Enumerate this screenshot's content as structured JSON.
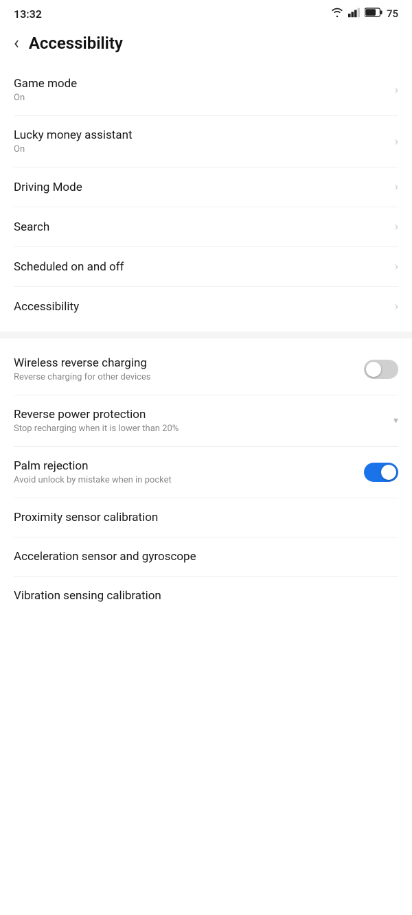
{
  "statusBar": {
    "time": "13:32",
    "battery": "75"
  },
  "header": {
    "backLabel": "‹",
    "title": "Accessibility"
  },
  "menuItems": [
    {
      "id": "game-mode",
      "title": "Game mode",
      "subtitle": "On",
      "control": "chevron"
    },
    {
      "id": "lucky-money",
      "title": "Lucky money assistant",
      "subtitle": "On",
      "control": "chevron"
    },
    {
      "id": "driving-mode",
      "title": "Driving Mode",
      "subtitle": "",
      "control": "chevron"
    },
    {
      "id": "search",
      "title": "Search",
      "subtitle": "",
      "control": "chevron"
    },
    {
      "id": "scheduled",
      "title": "Scheduled on and off",
      "subtitle": "",
      "control": "chevron"
    },
    {
      "id": "accessibility",
      "title": "Accessibility",
      "subtitle": "",
      "control": "chevron"
    }
  ],
  "hardwareItems": [
    {
      "id": "wireless-charging",
      "title": "Wireless reverse charging",
      "subtitle": "Reverse charging for other devices",
      "control": "toggle-off"
    },
    {
      "id": "reverse-protection",
      "title": "Reverse power protection",
      "subtitle": "Stop recharging when it is lower than 20%",
      "control": "dropdown"
    },
    {
      "id": "palm-rejection",
      "title": "Palm rejection",
      "subtitle": "Avoid unlock by mistake when in pocket",
      "control": "toggle-on"
    },
    {
      "id": "proximity-sensor",
      "title": "Proximity sensor calibration",
      "subtitle": "",
      "control": "none"
    },
    {
      "id": "acceleration-sensor",
      "title": "Acceleration sensor and gyroscope",
      "subtitle": "",
      "control": "none"
    },
    {
      "id": "vibration-sensing",
      "title": "Vibration sensing calibration",
      "subtitle": "",
      "control": "none"
    }
  ],
  "chevronChar": "›",
  "dropdownChar": "▾"
}
